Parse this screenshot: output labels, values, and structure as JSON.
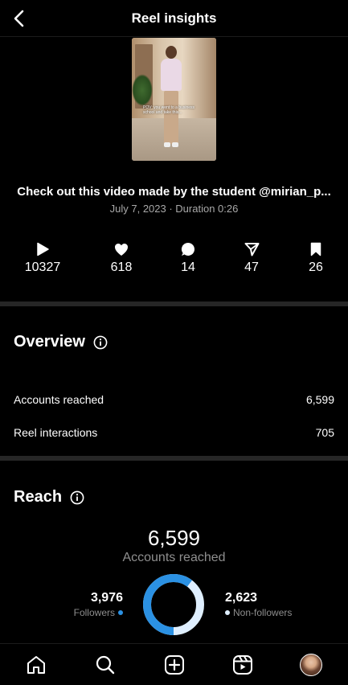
{
  "header": {
    "title": "Reel insights",
    "back_icon": "chevron-left-icon"
  },
  "reel": {
    "thumbnail_text": "POV: you went to a business school and take this...",
    "caption": "Check out this video made by the student @mirian_p...",
    "meta": "July 7, 2023 · Duration 0:26"
  },
  "stats": [
    {
      "icon": "play-icon",
      "value": "10327"
    },
    {
      "icon": "heart-icon",
      "value": "618"
    },
    {
      "icon": "comment-icon",
      "value": "14"
    },
    {
      "icon": "share-icon",
      "value": "47"
    },
    {
      "icon": "bookmark-icon",
      "value": "26"
    }
  ],
  "overview": {
    "title": "Overview",
    "rows": [
      {
        "label": "Accounts reached",
        "value": "6,599"
      },
      {
        "label": "Reel interactions",
        "value": "705"
      }
    ]
  },
  "reach": {
    "title": "Reach",
    "total": "6,599",
    "total_label": "Accounts reached",
    "followers": {
      "value": "3,976",
      "label": "Followers",
      "color": "#2b91e3",
      "count": 3976
    },
    "non_followers": {
      "value": "2,623",
      "label": "Non-followers",
      "color": "#dfefff",
      "count": 2623
    }
  },
  "nav": [
    "home-icon",
    "search-icon",
    "create-icon",
    "reels-icon",
    "profile-avatar"
  ]
}
